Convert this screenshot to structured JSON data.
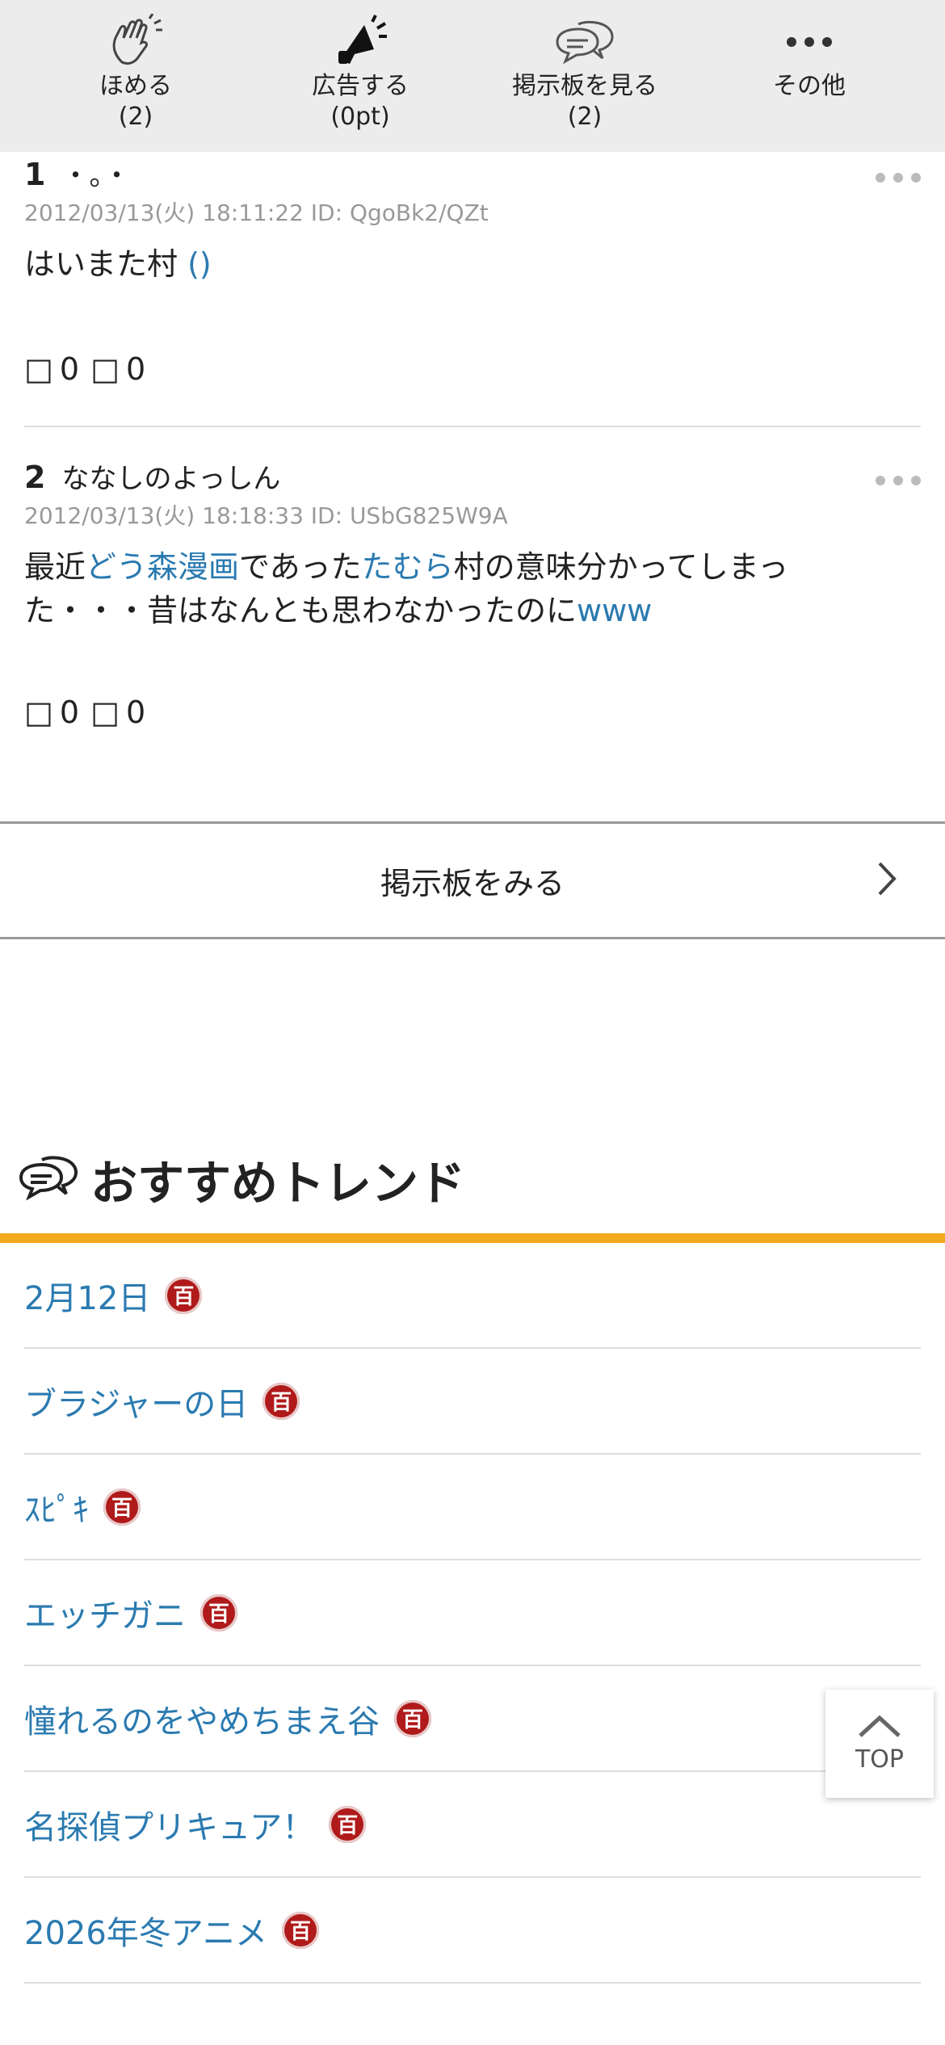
{
  "toolbar": {
    "items": [
      {
        "label": "ほめる",
        "count": "(2)",
        "icon": "clap-icon"
      },
      {
        "label": "広告する",
        "count": "(0pt)",
        "icon": "megaphone-icon"
      },
      {
        "label": "掲示板を見る",
        "count": "(2)",
        "icon": "chat-bubbles-icon"
      },
      {
        "label": "その他",
        "count": "",
        "icon": "more-dots-icon"
      }
    ]
  },
  "posts": [
    {
      "number": "1",
      "name": "・。・",
      "meta": "2012/03/13(火) 18:11:22 ID: QgoBk2/QZt",
      "body_plain_1": "はいまた村",
      "body_link_1": "()",
      "good_icon": "□",
      "good": "0",
      "bad_icon": "□",
      "bad": "0"
    },
    {
      "number": "2",
      "name": "ななしのよっしん",
      "meta": "2012/03/13(火) 18:18:33 ID: USbG825W9A",
      "body_plain_1": "最近",
      "body_link_1": "どう森漫画",
      "body_plain_2": "であった",
      "body_link_2": "たむら",
      "body_plain_3": "村の意味分かってしまった・・・昔はなんとも思わなかったのに",
      "body_link_3": "www",
      "good_icon": "□",
      "good": "0",
      "bad_icon": "□",
      "bad": "0"
    }
  ],
  "view_board": {
    "label": "掲示板をみる"
  },
  "trends": {
    "title": "おすすめトレンド",
    "badge": "百",
    "items": [
      {
        "label": "2月12日"
      },
      {
        "label": "ブラジャーの日"
      },
      {
        "label": "ｽﾋﾟｷ"
      },
      {
        "label": "エッチガニ"
      },
      {
        "label": "憧れるのをやめちまえ谷"
      },
      {
        "label": "名探偵プリキュア！"
      },
      {
        "label": "2026年冬アニメ"
      }
    ]
  },
  "top_button": {
    "label": "TOP"
  },
  "colors": {
    "accent": "#f3a91c",
    "link": "#2a7ab0",
    "badge": "#b01a1a",
    "toolbar_bg": "#ececec"
  }
}
